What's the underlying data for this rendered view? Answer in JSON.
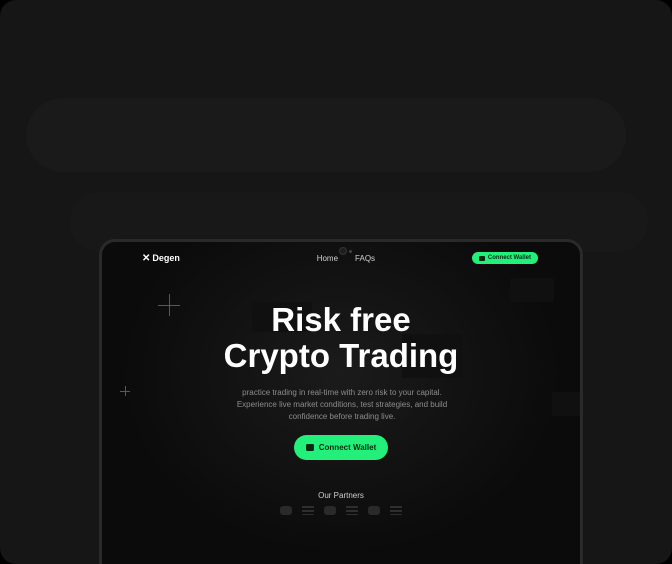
{
  "nav": {
    "brand_mark": "✕",
    "brand_name": "Degen",
    "links": [
      "Home",
      "FAQs"
    ],
    "connect_label": "Connect Wallet"
  },
  "hero": {
    "title_line1": "Risk free",
    "title_line2": "Crypto Trading",
    "subtitle_line1": "practice trading in real-time with zero risk to your capital.",
    "subtitle_line2": "Experience live market conditions, test strategies, and build",
    "subtitle_line3": "confidence before trading live.",
    "cta_label": "Connect Wallet"
  },
  "partners": {
    "title": "Our Partners"
  },
  "colors": {
    "accent": "#22f07a",
    "background": "#0b0b0b",
    "frame": "#161616"
  },
  "icons": [
    "wallet-icon",
    "brand-x-icon",
    "camera-icon"
  ]
}
